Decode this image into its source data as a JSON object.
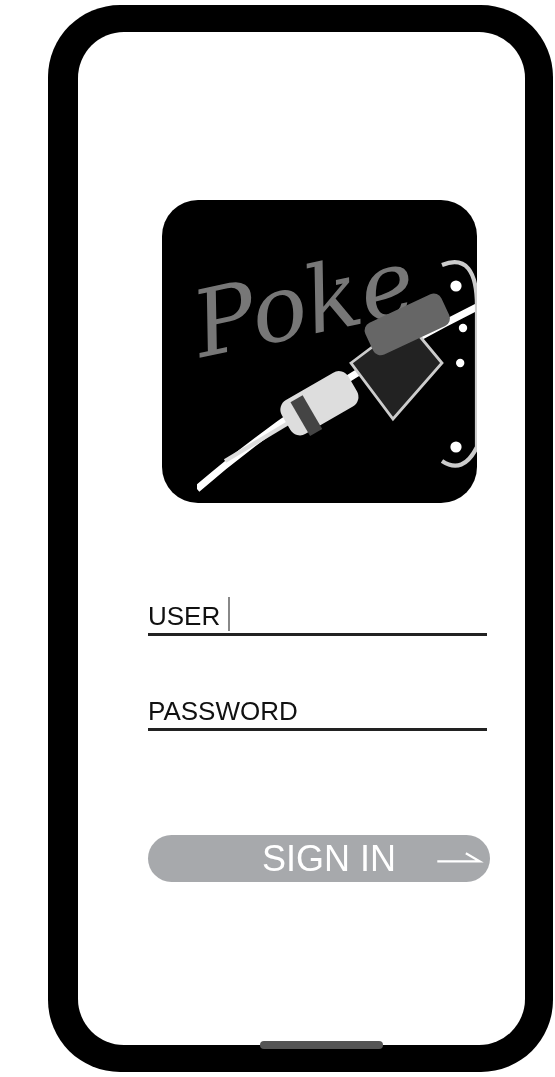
{
  "logo": {
    "text": "Poke"
  },
  "fields": [
    {
      "label": "USER",
      "focused": true
    },
    {
      "label": "PASSWORD",
      "focused": false
    }
  ],
  "button": {
    "label": "SIGN IN"
  }
}
